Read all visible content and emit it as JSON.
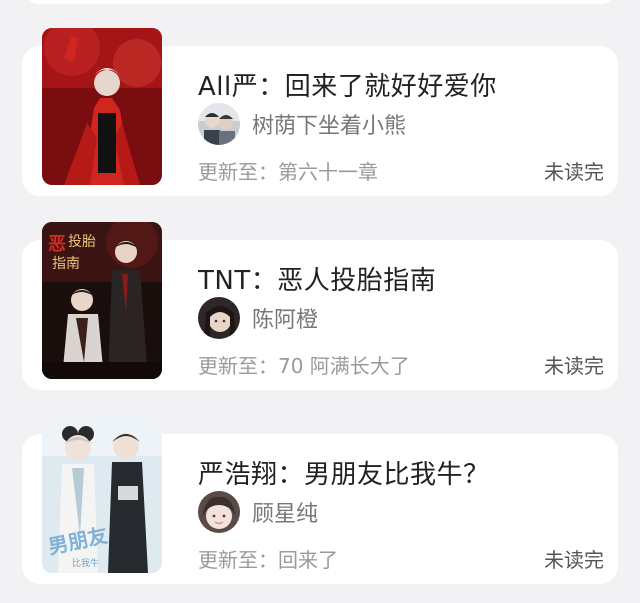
{
  "books": [
    {
      "title": "All严：回来了就好好爱你",
      "author": "树荫下坐着小熊",
      "update": "更新至：第六十一章",
      "status": "未读完"
    },
    {
      "title": "TNT：恶人投胎指南",
      "author": "陈阿橙",
      "update": "更新至：70 阿满长大了",
      "status": "未读完"
    },
    {
      "title": "严浩翔：男朋友比我牛？",
      "author": "顾星纯",
      "update": "更新至：回来了",
      "status": "未读完"
    }
  ],
  "colors": {
    "background": "#f2f2f4",
    "card": "#ffffff",
    "title_text": "#222222",
    "author_text": "#777777",
    "update_text": "#9a9a9a",
    "status_text": "#555555"
  }
}
